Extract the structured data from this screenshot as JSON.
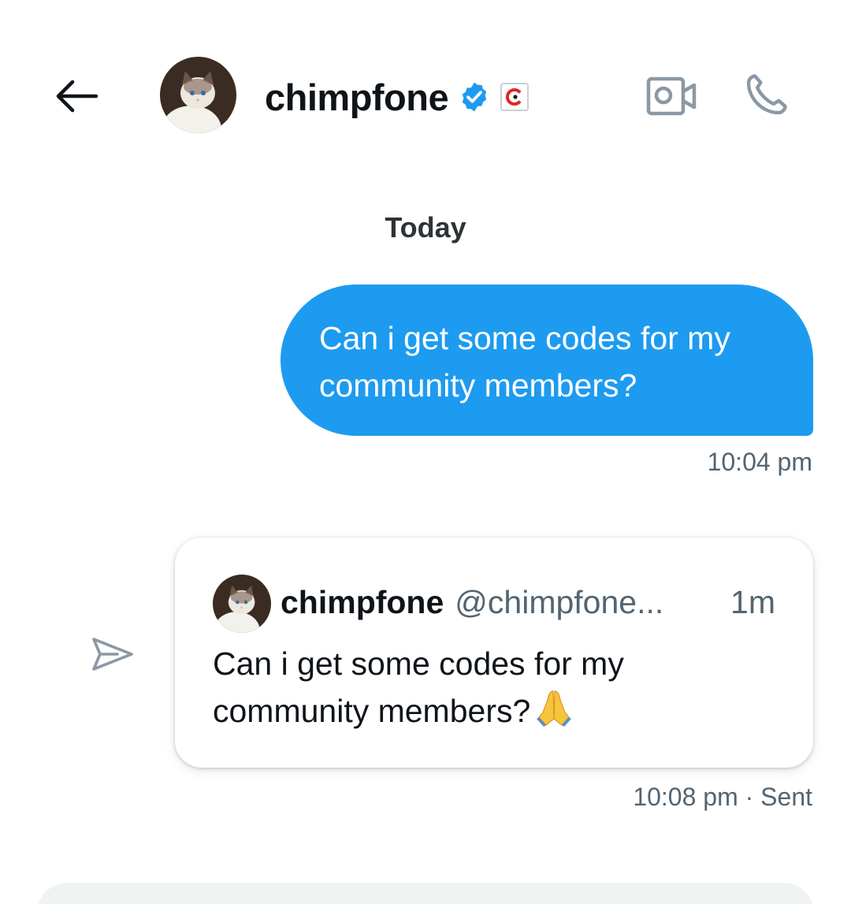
{
  "header": {
    "name": "chimpfone",
    "verified_icon": "verified-badge-icon",
    "affiliate_icon": "affiliate-badge-icon",
    "back_icon": "back-arrow-icon",
    "video_icon": "video-call-icon",
    "call_icon": "phone-call-icon"
  },
  "conversation": {
    "date_label": "Today",
    "messages": [
      {
        "direction": "outgoing",
        "text": "Can i get some codes for my community members?",
        "time": "10:04 pm",
        "bubble_color": "#1d9bf0"
      },
      {
        "direction": "outgoing",
        "type": "shared-post",
        "post": {
          "author_name": "chimpfone",
          "author_handle": "@chimpfone...",
          "age": "1m",
          "text": "Can i get some codes for my community members?"
        },
        "time_status": "10:08 pm · Sent",
        "share_icon": "send-icon"
      }
    ]
  },
  "colors": {
    "accent": "#1d9bf0",
    "text_primary": "#0f1419",
    "text_secondary": "#536471",
    "composer_bg": "#eff3f4"
  }
}
